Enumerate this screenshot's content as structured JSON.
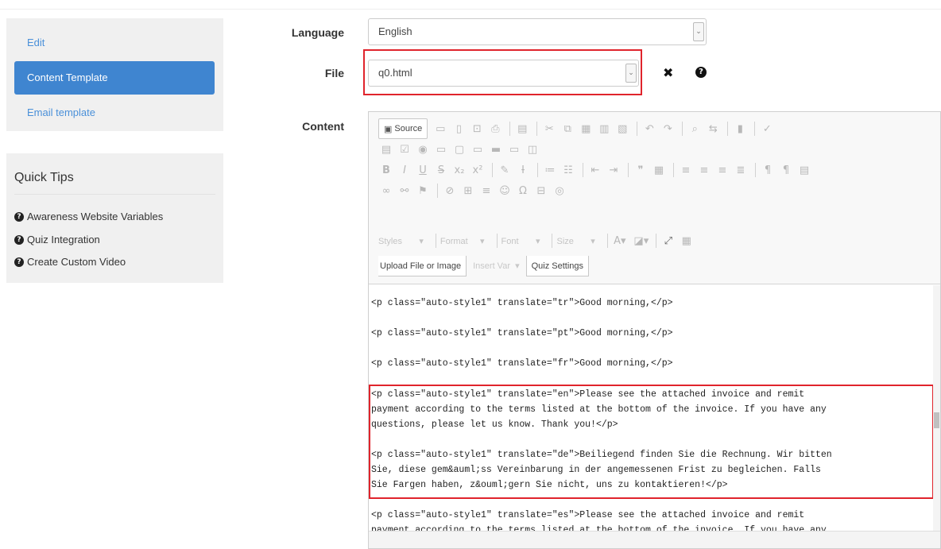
{
  "sidebar": {
    "items": [
      {
        "label": "Edit"
      },
      {
        "label": "Content Template"
      },
      {
        "label": "Email template"
      }
    ]
  },
  "quick_tips": {
    "title": "Quick Tips",
    "items": [
      {
        "label": "Awareness Website Variables"
      },
      {
        "label": "Quiz Integration"
      },
      {
        "label": "Create Custom Video"
      }
    ]
  },
  "form": {
    "language_label": "Language",
    "language_value": "English",
    "file_label": "File",
    "file_value": "q0.html",
    "content_label": "Content",
    "remove_icon": "✖",
    "help_icon": "?"
  },
  "toolbar": {
    "source_label": "Source",
    "styles_label": "Styles",
    "format_label": "Format",
    "font_label": "Font",
    "size_label": "Size",
    "upload_label": "Upload File or Image",
    "insert_var_label": "Insert Var",
    "quiz_settings_label": "Quiz Settings"
  },
  "code_lines": [
    "<p class=\"auto-style1\" translate=\"tr\">Good morning,</p>",
    "<p class=\"auto-style1\" translate=\"pt\">Good morning,</p>",
    "<p class=\"auto-style1\" translate=\"fr\">Good morning,</p>",
    "<p class=\"auto-style1\" translate=\"en\">Please see the attached invoice and remit",
    "payment according to the terms listed at the bottom of the invoice. If you have any",
    "questions, please let us know. Thank you!</p>",
    "<p class=\"auto-style1\" translate=\"de\">Beiliegend finden Sie die Rechnung. Wir bitten",
    "Sie, diese gem&auml;ss Vereinbarung in der angemessenen Frist zu begleichen. Falls",
    "Sie Fargen haben, z&ouml;gern Sie nicht, uns zu kontaktieren!</p>",
    "<p class=\"auto-style1\" translate=\"es\">Please see the attached invoice and remit",
    "payment according to the terms listed at the bottom of the invoice. If you have any"
  ]
}
